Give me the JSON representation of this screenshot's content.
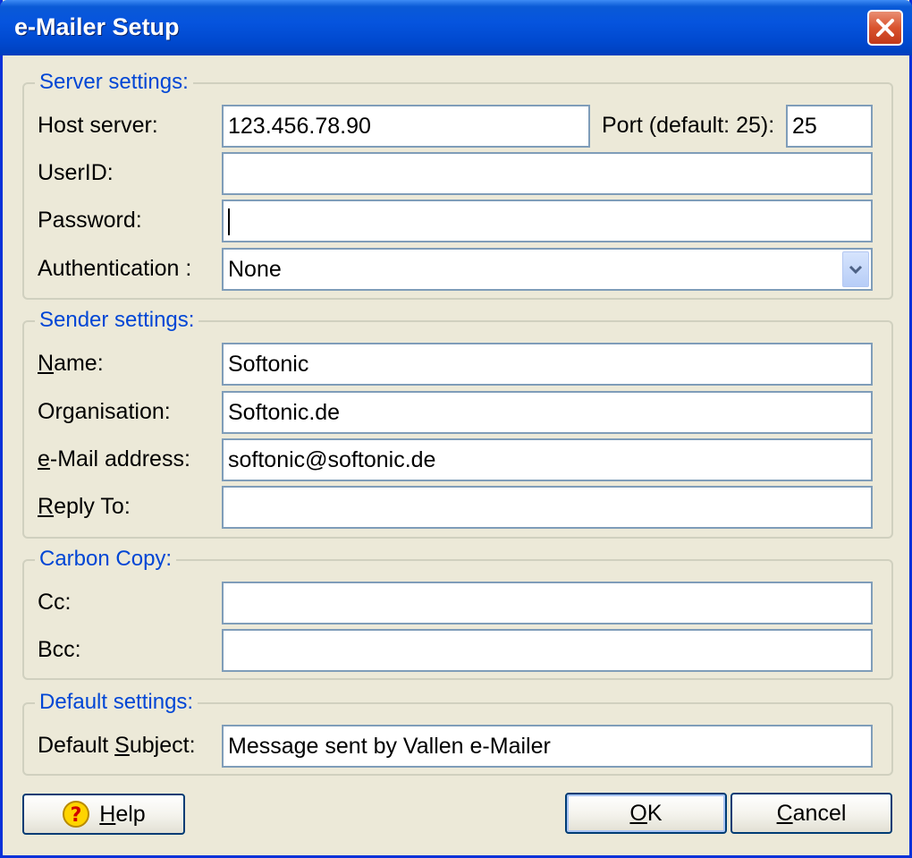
{
  "window": {
    "title": "e-Mailer Setup"
  },
  "server": {
    "legend": "Server settings:",
    "host_label": "Host server:",
    "host_value": "123.456.78.90",
    "port_label": "Port (default: 25):",
    "port_value": "25",
    "userid_label": "UserID:",
    "userid_value": "",
    "password_label": "Password:",
    "password_value": "",
    "auth_label": "Authentication :",
    "auth_value": "None"
  },
  "sender": {
    "legend": "Sender settings:",
    "name_label_key": "N",
    "name_label_rest": "ame:",
    "name_value": "Softonic",
    "org_label": "Organisation:",
    "org_value": "Softonic.de",
    "email_label_key": "e",
    "email_label_rest": "-Mail address:",
    "email_value": "softonic@softonic.de",
    "reply_label_key": "R",
    "reply_label_rest": "eply To:",
    "reply_value": ""
  },
  "carbon": {
    "legend": "Carbon Copy:",
    "cc_label": "Cc:",
    "cc_value": "",
    "bcc_label": "Bcc:",
    "bcc_value": ""
  },
  "defaults": {
    "legend": "Default settings:",
    "subject_label_pre": "Default ",
    "subject_label_key": "S",
    "subject_label_rest": "ubject:",
    "subject_value": "Message sent by Vallen e-Mailer"
  },
  "buttons": {
    "help_key": "H",
    "help_rest": "elp",
    "ok_key": "O",
    "ok_rest": "K",
    "cancel_key": "C",
    "cancel_rest": "ancel"
  },
  "icons": {
    "close": "close-icon",
    "dropdown": "chevron-down-icon",
    "help": "question-mark-icon"
  },
  "colors": {
    "titlebar": "#0654de",
    "dialog_bg": "#ece9d8",
    "legend_text": "#0046d5",
    "close_button": "#d9532e",
    "field_border": "#7f9db9"
  }
}
